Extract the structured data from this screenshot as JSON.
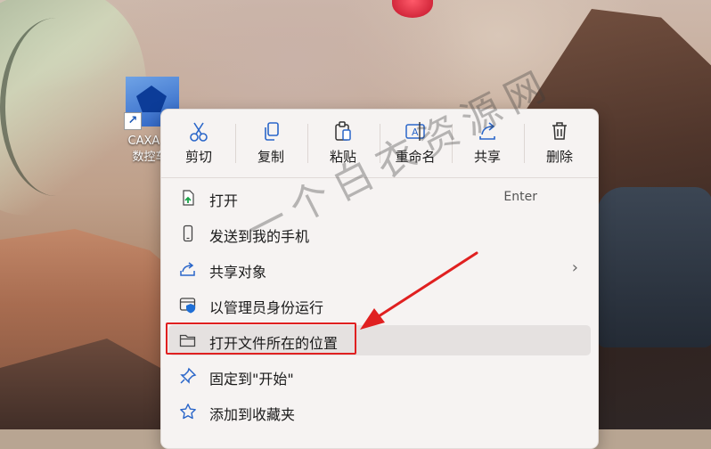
{
  "desktop": {
    "icon_label_line1": "CAXA C",
    "icon_label_line2": "数控车",
    "shortcut_glyph": "↗"
  },
  "quick_actions": [
    {
      "label": "剪切",
      "icon": "scissors-icon"
    },
    {
      "label": "复制",
      "icon": "copy-icon"
    },
    {
      "label": "粘贴",
      "icon": "paste-icon"
    },
    {
      "label": "重命名",
      "icon": "rename-icon"
    },
    {
      "label": "共享",
      "icon": "share-icon"
    },
    {
      "label": "删除",
      "icon": "trash-icon"
    }
  ],
  "menu_items": [
    {
      "label": "打开",
      "shortcut": "Enter",
      "icon": "open-file-icon"
    },
    {
      "label": "发送到我的手机",
      "icon": "phone-icon"
    },
    {
      "label": "共享对象",
      "icon": "share-icon",
      "submenu_arrow": "›"
    },
    {
      "label": "以管理员身份运行",
      "icon": "admin-shield-icon"
    },
    {
      "label": "打开文件所在的位置",
      "icon": "folder-icon",
      "highlighted": true
    },
    {
      "label": "固定到\"开始\"",
      "icon": "pin-icon"
    },
    {
      "label": "添加到收藏夹",
      "icon": "star-icon"
    }
  ],
  "watermark": "一个白衣资源网",
  "colors": {
    "accent": "#1f6fd6",
    "menu_bg": "#f6f3f2",
    "highlight": "#e5e1e0",
    "annotation_red": "#e02020"
  }
}
